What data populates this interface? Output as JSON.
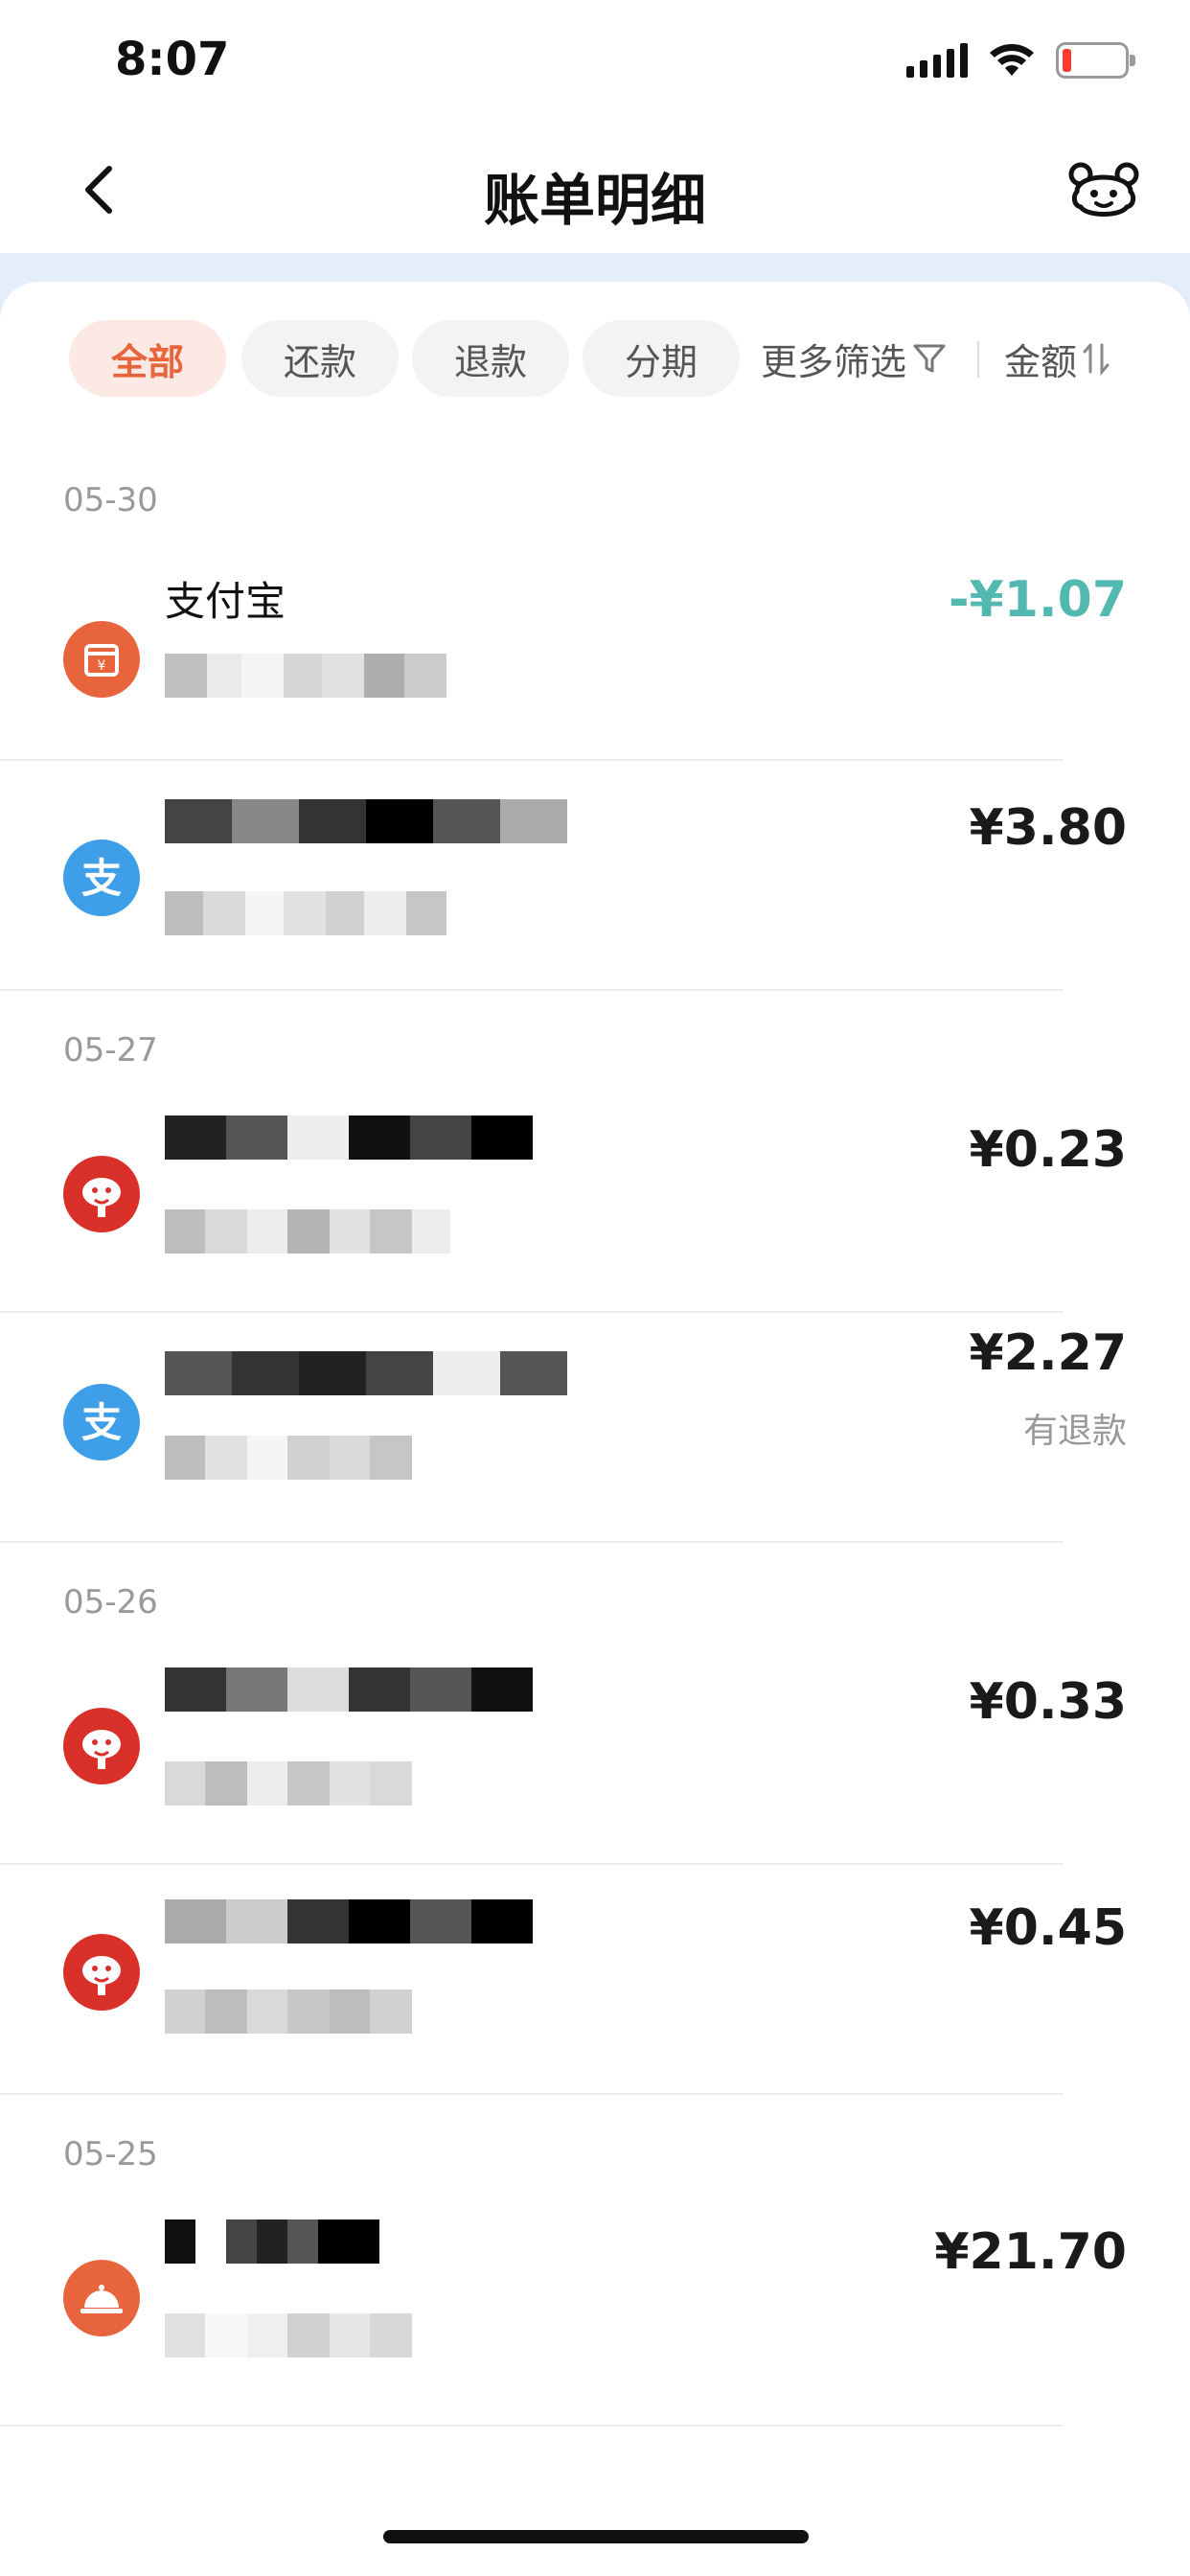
{
  "status": {
    "time": "8:07"
  },
  "nav": {
    "title": "账单明细"
  },
  "filters": {
    "chips": [
      "全部",
      "还款",
      "退款",
      "分期"
    ],
    "more": "更多筛选",
    "sort": "金额"
  },
  "groups": [
    {
      "date": "05-30"
    },
    {
      "date": "05-27"
    },
    {
      "date": "05-26"
    },
    {
      "date": "05-25"
    }
  ],
  "transactions": [
    {
      "icon": "wallet-icon",
      "name": "支付宝",
      "amount": "-¥1.07",
      "note": ""
    },
    {
      "icon": "alipay-icon",
      "name": "",
      "amount": "¥3.80",
      "note": ""
    },
    {
      "icon": "jd-dog-icon",
      "name": "",
      "amount": "¥0.23",
      "note": ""
    },
    {
      "icon": "alipay-icon",
      "name": "",
      "amount": "¥2.27",
      "note": "有退款"
    },
    {
      "icon": "jd-dog-icon",
      "name": "",
      "amount": "¥0.33",
      "note": ""
    },
    {
      "icon": "jd-dog-icon",
      "name": "",
      "amount": "¥0.45",
      "note": ""
    },
    {
      "icon": "food-cloche-icon",
      "name": "",
      "amount": "¥21.70",
      "note": ""
    }
  ],
  "colors": {
    "accent": "#e8643c",
    "refund_amount": "#52b8b0",
    "alipay_blue": "#3f9ee8",
    "jd_red": "#d9302a",
    "band": "#e4eefb"
  }
}
